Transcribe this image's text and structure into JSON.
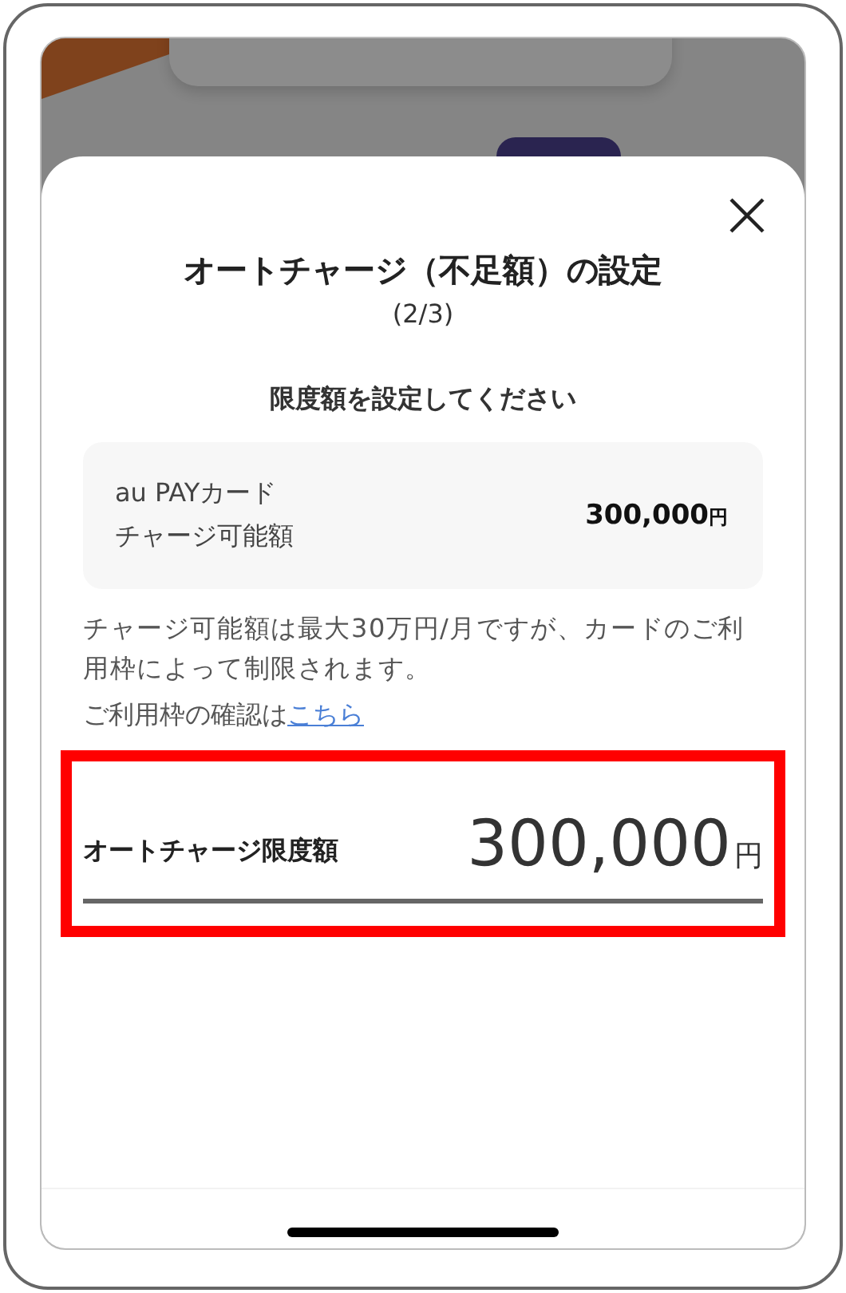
{
  "sheet": {
    "title": "オートチャージ（不足額）の設定",
    "step": "(2/3)"
  },
  "prompt": "限度額を設定してください",
  "card": {
    "label_lines": [
      "au PAYカード",
      "チャージ可能額"
    ],
    "amount": "300,000",
    "unit": "円"
  },
  "note": {
    "text": "チャージ可能額は最大30万円/月ですが、カードのご利用枠によって制限されます。",
    "link_prefix": "ご利用枠の確認は",
    "link": "こちら"
  },
  "limit_field": {
    "label": "オートチャージ限度額",
    "value": "300,000",
    "unit": "円"
  }
}
